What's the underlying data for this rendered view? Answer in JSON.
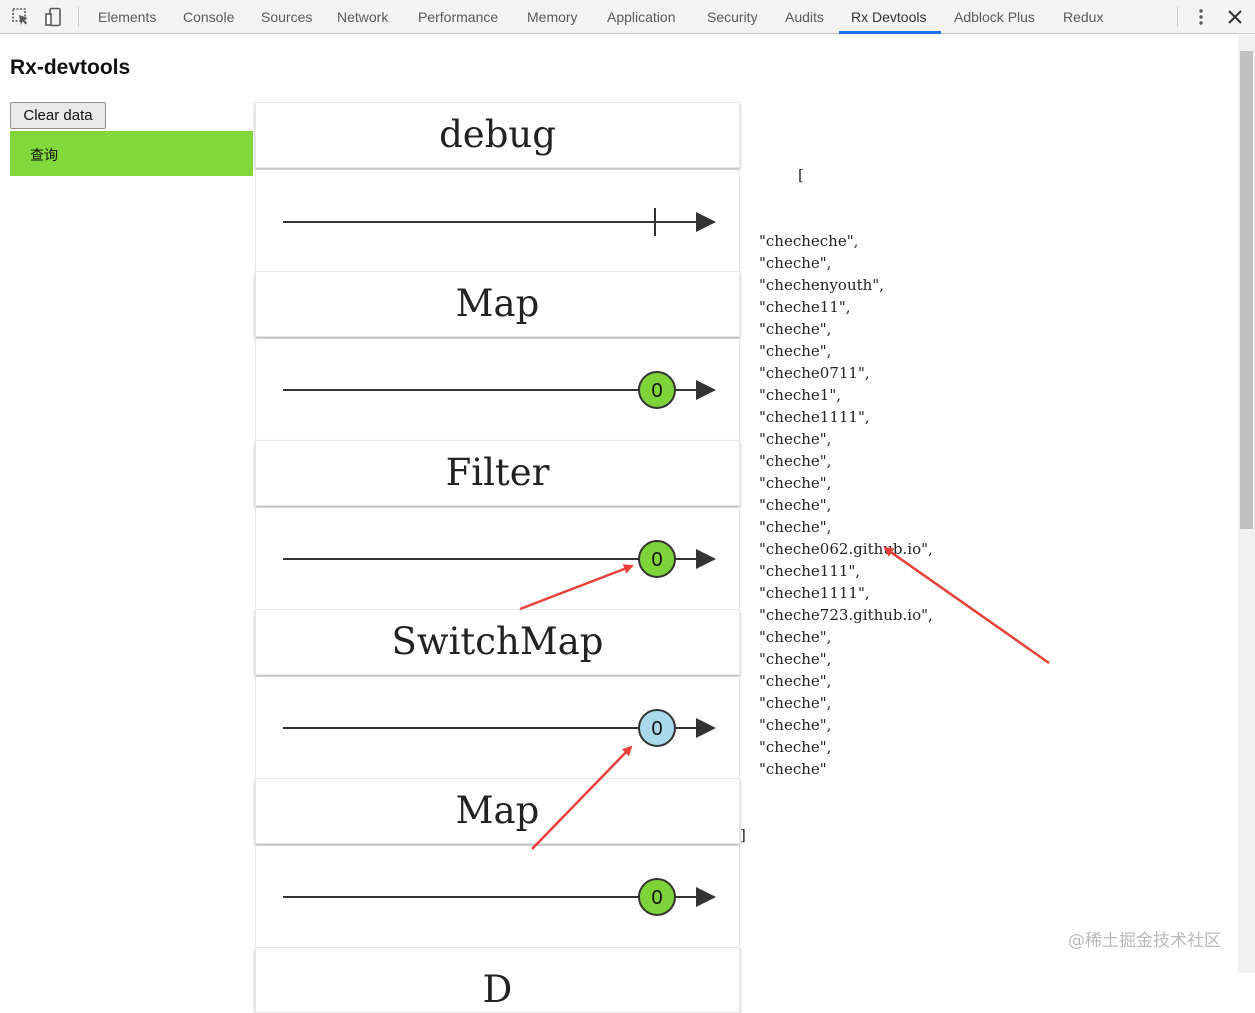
{
  "devtools": {
    "tabs": [
      {
        "label": "Elements"
      },
      {
        "label": "Console"
      },
      {
        "label": "Sources"
      },
      {
        "label": "Network"
      },
      {
        "label": "Performance"
      },
      {
        "label": "Memory"
      },
      {
        "label": "Application"
      },
      {
        "label": "Security"
      },
      {
        "label": "Audits"
      },
      {
        "label": "Rx Devtools",
        "active": true
      },
      {
        "label": "Adblock Plus"
      },
      {
        "label": "Redux"
      }
    ],
    "accent_color": "#1a73e8"
  },
  "page": {
    "title": "Rx-devtools",
    "clear_button": "Clear data",
    "query_label": "查询",
    "query_color": "#80d83a"
  },
  "operators": [
    {
      "name": "debug",
      "marble": {
        "type": "complete"
      }
    },
    {
      "name": "Map",
      "marble": {
        "type": "value",
        "label": "0",
        "color": "#7ed23a"
      }
    },
    {
      "name": "Filter",
      "marble": {
        "type": "value",
        "label": "0",
        "color": "#7ed23a"
      }
    },
    {
      "name": "SwitchMap",
      "marble": {
        "type": "value",
        "label": "0",
        "color": "#a9d8ea"
      }
    },
    {
      "name": "Map",
      "marble": {
        "type": "value",
        "label": "0",
        "color": "#7ed23a"
      }
    },
    {
      "name": "D"
    }
  ],
  "json_output": {
    "open": "[",
    "items": [
      "\"checheche\",",
      "\"cheche\",",
      "\"chechenyouth\",",
      "\"cheche11\",",
      "\"cheche\",",
      "\"cheche\",",
      "\"cheche0711\",",
      "\"cheche1\",",
      "\"cheche1111\",",
      "\"cheche\",",
      "\"cheche\",",
      "\"cheche\",",
      "\"cheche\",",
      "\"cheche\",",
      "\"cheche062.github.io\",",
      "\"cheche111\",",
      "\"cheche1111\",",
      "\"cheche723.github.io\",",
      "\"cheche\",",
      "\"cheche\",",
      "\"cheche\",",
      "\"cheche\",",
      "\"cheche\",",
      "\"cheche\",",
      "\"cheche\""
    ],
    "close": "]"
  },
  "watermark": "@稀土掘金技术社区"
}
